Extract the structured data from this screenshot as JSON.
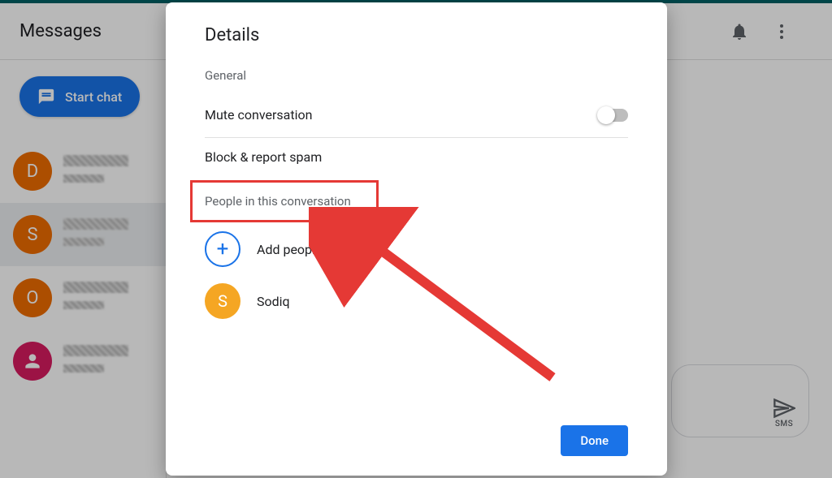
{
  "header": {
    "title": "Messages",
    "start_chat_label": "Start chat"
  },
  "sidebar": {
    "items": [
      {
        "initial": "D"
      },
      {
        "initial": "S"
      },
      {
        "initial": "O"
      },
      {
        "initial": ""
      }
    ]
  },
  "compose": {
    "sms_label": "SMS"
  },
  "dialog": {
    "title": "Details",
    "section_general": "General",
    "mute_label": "Mute conversation",
    "mute_on": false,
    "block_label": "Block & report spam",
    "people_label": "People in this conversation",
    "add_people_label": "Add people",
    "contacts": [
      {
        "name": "Sodiq",
        "initial": "S"
      }
    ],
    "done_label": "Done"
  },
  "icons": {
    "bell": "notifications",
    "more": "more_vert",
    "chat": "chat",
    "person": "person",
    "send": "send"
  }
}
